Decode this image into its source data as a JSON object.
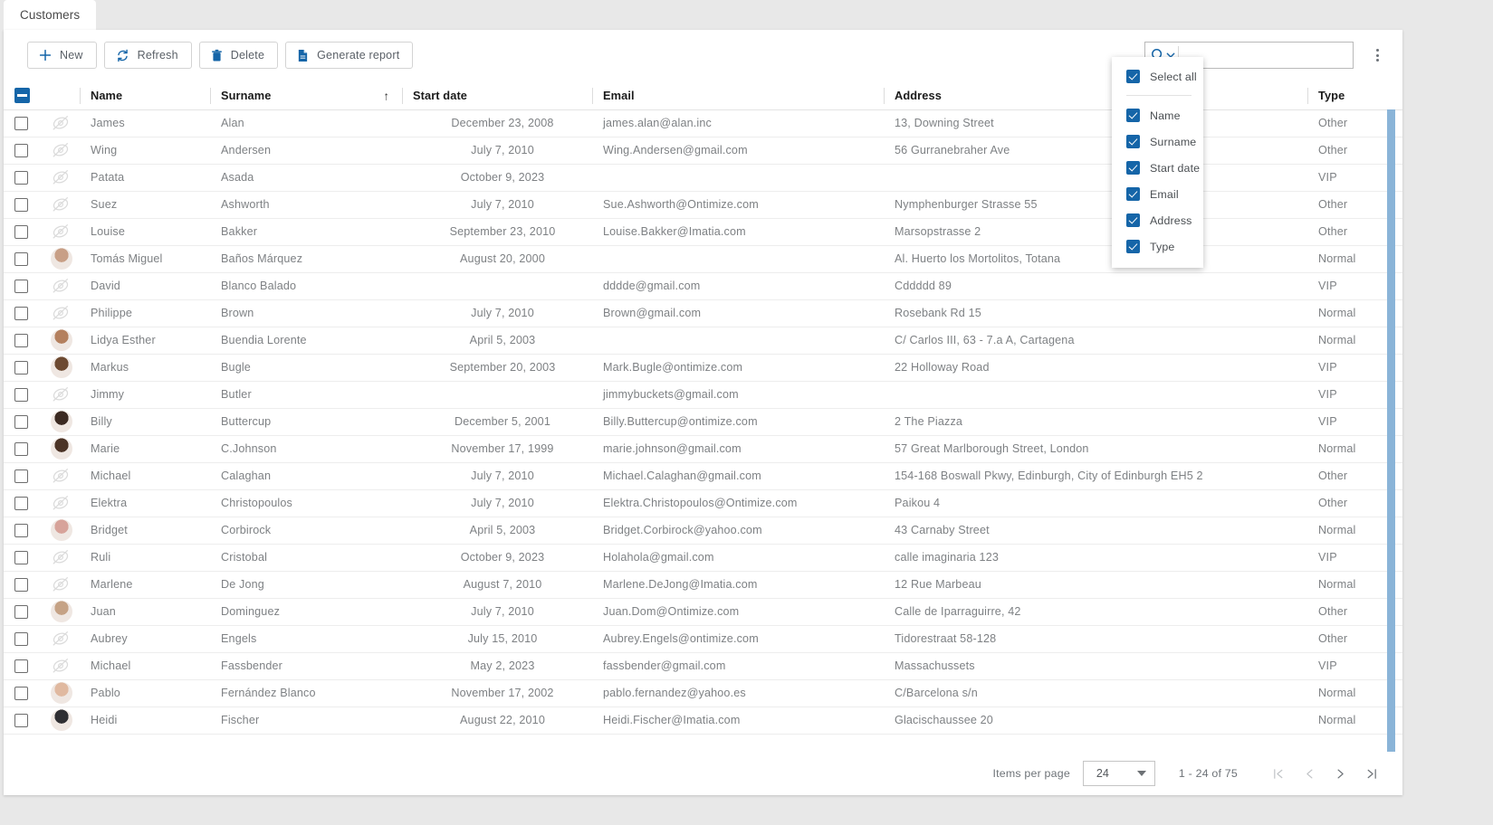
{
  "tab": {
    "label": "Customers"
  },
  "toolbar": {
    "buttons": [
      {
        "label": "New",
        "icon": "plus-icon"
      },
      {
        "label": "Refresh",
        "icon": "refresh-icon"
      },
      {
        "label": "Delete",
        "icon": "trash-icon"
      },
      {
        "label": "Generate report",
        "icon": "document-icon"
      }
    ],
    "search": {
      "value": "",
      "placeholder": ""
    },
    "more_icon": "kebab-menu-icon"
  },
  "column_menu": {
    "select_all": "Select all",
    "items": [
      {
        "label": "Name",
        "checked": true
      },
      {
        "label": "Surname",
        "checked": true
      },
      {
        "label": "Start date",
        "checked": true
      },
      {
        "label": "Email",
        "checked": true
      },
      {
        "label": "Address",
        "checked": true
      },
      {
        "label": "Type",
        "checked": true
      }
    ]
  },
  "table": {
    "columns": [
      "Name",
      "Surname",
      "Start date",
      "Email",
      "Address",
      "Type"
    ],
    "sorted_column": "Surname",
    "sort_direction": "asc",
    "sort_glyph": "↑",
    "header_select_state": "indeterminate",
    "rows": [
      {
        "name": "James",
        "surname": "Alan",
        "date": "December 23, 2008",
        "email": "james.alan@alan.inc",
        "address": "13, Downing Street",
        "type": "Other",
        "avatar": false
      },
      {
        "name": "Wing",
        "surname": "Andersen",
        "date": "July 7, 2010",
        "email": "Wing.Andersen@gmail.com",
        "address": "56 Gurranebraher Ave",
        "type": "Other",
        "avatar": false
      },
      {
        "name": "Patata",
        "surname": "Asada",
        "date": "October 9, 2023",
        "email": "",
        "address": "",
        "type": "VIP",
        "avatar": false
      },
      {
        "name": "Suez",
        "surname": "Ashworth",
        "date": "July 7, 2010",
        "email": "Sue.Ashworth@Ontimize.com",
        "address": "Nymphenburger Strasse 55",
        "type": "Other",
        "avatar": false
      },
      {
        "name": "Louise",
        "surname": "Bakker",
        "date": "September 23, 2010",
        "email": "Louise.Bakker@Imatia.com",
        "address": "Marsopstrasse 2",
        "type": "Other",
        "avatar": false
      },
      {
        "name": "Tomás Miguel",
        "surname": "Baños Márquez",
        "date": "August 20, 2000",
        "email": "",
        "address": "Al. Huerto los Mortolitos, Totana",
        "type": "Normal",
        "avatar": true,
        "avatar_color": "#c89f86"
      },
      {
        "name": "David",
        "surname": "Blanco Balado",
        "date": "",
        "email": "dddde@gmail.com",
        "address": "Cddddd 89",
        "type": "VIP",
        "avatar": false
      },
      {
        "name": "Philippe",
        "surname": "Brown",
        "date": "July 7, 2010",
        "email": "Brown@gmail.com",
        "address": "Rosebank Rd 15",
        "type": "Normal",
        "avatar": false
      },
      {
        "name": "Lidya Esther",
        "surname": "Buendia Lorente",
        "date": "April 5, 2003",
        "email": "",
        "address": "C/ Carlos III, 63 - 7.a A, Cartagena",
        "type": "Normal",
        "avatar": true,
        "avatar_color": "#b4805e"
      },
      {
        "name": "Markus",
        "surname": "Bugle",
        "date": "September 20, 2003",
        "email": "Mark.Bugle@ontimize.com",
        "address": "22 Holloway Road",
        "type": "VIP",
        "avatar": true,
        "avatar_color": "#6d4a32"
      },
      {
        "name": "Jimmy",
        "surname": "Butler",
        "date": "",
        "email": "jimmybuckets@gmail.com",
        "address": "",
        "type": "VIP",
        "avatar": false
      },
      {
        "name": "Billy",
        "surname": "Buttercup",
        "date": "December 5, 2001",
        "email": "Billy.Buttercup@ontimize.com",
        "address": "2 The Piazza",
        "type": "VIP",
        "avatar": true,
        "avatar_color": "#3b2a22"
      },
      {
        "name": "Marie",
        "surname": "C.Johnson",
        "date": "November 17, 1999",
        "email": "marie.johnson@gmail.com",
        "address": "57 Great Marlborough Street, London",
        "type": "Normal",
        "avatar": true,
        "avatar_color": "#4b3326"
      },
      {
        "name": "Michael",
        "surname": "Calaghan",
        "date": "July 7, 2010",
        "email": "Michael.Calaghan@gmail.com",
        "address": "154-168 Boswall Pkwy, Edinburgh, City of Edinburgh EH5 2",
        "type": "Other",
        "avatar": false
      },
      {
        "name": "Elektra",
        "surname": "Christopoulos",
        "date": "July 7, 2010",
        "email": "Elektra.Christopoulos@Ontimize.com",
        "address": "Paikou 4",
        "type": "Other",
        "avatar": false
      },
      {
        "name": "Bridget",
        "surname": "Corbirock",
        "date": "April 5, 2003",
        "email": "Bridget.Corbirock@yahoo.com",
        "address": "43 Carnaby Street",
        "type": "Normal",
        "avatar": true,
        "avatar_color": "#d7a39a"
      },
      {
        "name": "Ruli",
        "surname": "Cristobal",
        "date": "October 9, 2023",
        "email": "Holahola@gmail.com",
        "address": "calle imaginaria 123",
        "type": "VIP",
        "avatar": false
      },
      {
        "name": "Marlene",
        "surname": "De Jong",
        "date": "August 7, 2010",
        "email": "Marlene.DeJong@Imatia.com",
        "address": "12 Rue Marbeau",
        "type": "Normal",
        "avatar": false
      },
      {
        "name": "Juan",
        "surname": "Dominguez",
        "date": "July 7, 2010",
        "email": "Juan.Dom@Ontimize.com",
        "address": "Calle de Iparraguirre, 42",
        "type": "Other",
        "avatar": true,
        "avatar_color": "#c5a285"
      },
      {
        "name": "Aubrey",
        "surname": "Engels",
        "date": "July 15, 2010",
        "email": "Aubrey.Engels@ontimize.com",
        "address": "Tidorestraat 58-128",
        "type": "Other",
        "avatar": false
      },
      {
        "name": "Michael",
        "surname": "Fassbender",
        "date": "May 2, 2023",
        "email": "fassbender@gmail.com",
        "address": "Massachussets",
        "type": "VIP",
        "avatar": false
      },
      {
        "name": "Pablo",
        "surname": "Fernández Blanco",
        "date": "November 17, 2002",
        "email": "pablo.fernandez@yahoo.es",
        "address": "C/Barcelona s/n",
        "type": "Normal",
        "avatar": true,
        "avatar_color": "#e0b9a0"
      },
      {
        "name": "Heidi",
        "surname": "Fischer",
        "date": "August 22, 2010",
        "email": "Heidi.Fischer@Imatia.com",
        "address": "Glacischaussee 20",
        "type": "Normal",
        "avatar": true,
        "avatar_color": "#2f2f33"
      }
    ]
  },
  "paginator": {
    "items_per_page_label": "Items per page",
    "items_per_page_value": "24",
    "range_label": "1 - 24 of 75",
    "first_icon": "first-page-icon",
    "prev_icon": "prev-page-icon",
    "next_icon": "next-page-icon",
    "last_icon": "last-page-icon"
  },
  "colors": {
    "accent": "#1565a8",
    "scrollbar": "#8ab4d8",
    "text_muted": "#7e8184"
  }
}
